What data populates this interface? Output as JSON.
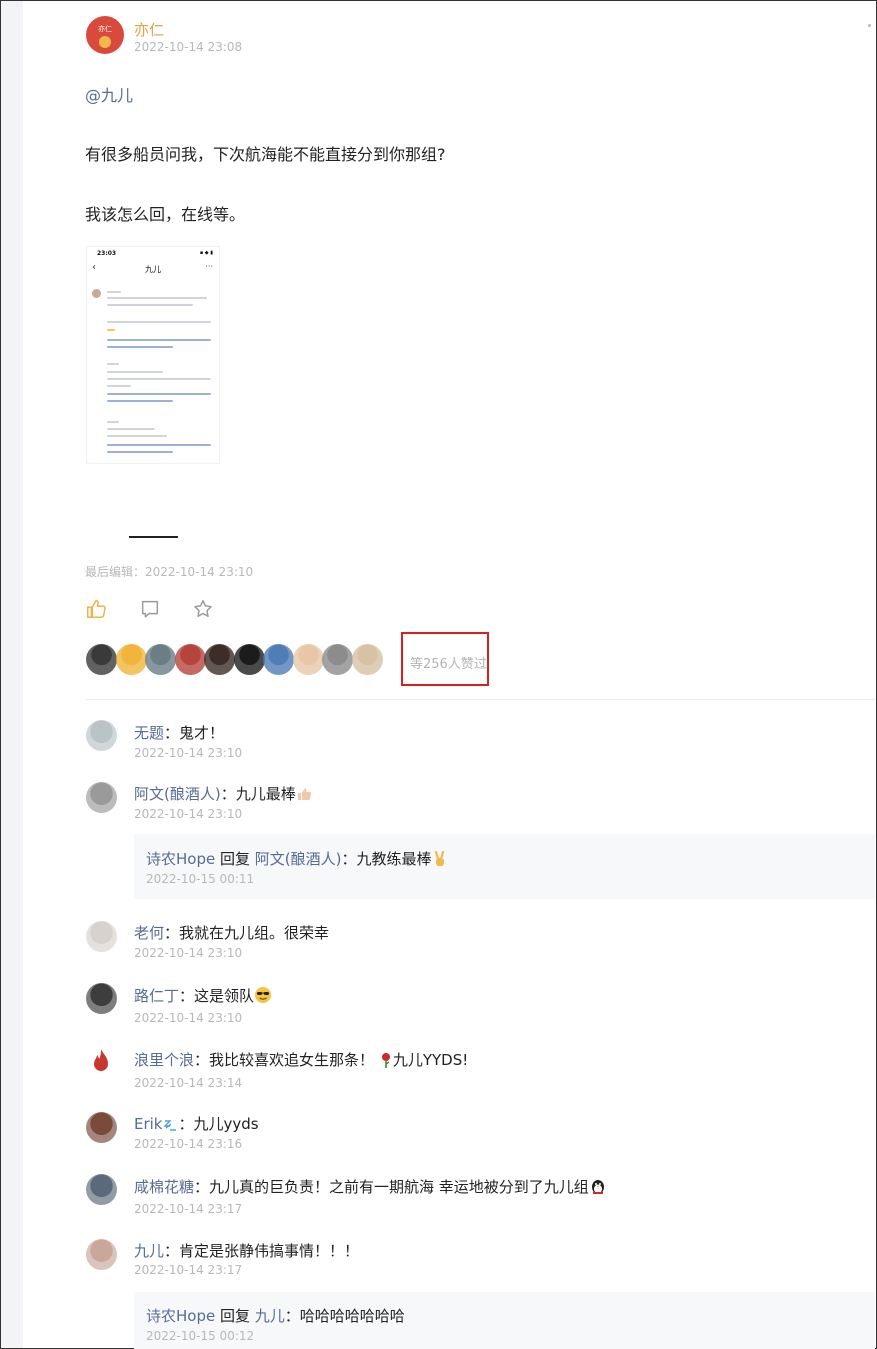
{
  "post": {
    "author": "亦仁",
    "author_avatar_text": "亦仁",
    "time": "2022-10-14 23:08",
    "mention": "@九儿",
    "paragraphs": [
      "有很多船员问我，下次航海能不能直接分到你那组?",
      "我该怎么回，在线等。"
    ],
    "last_edited": "最后编辑：2022-10-14 23:10"
  },
  "screenshot_thumb": {
    "status_time": "23:03",
    "title": "九儿",
    "back": "‹",
    "more": "···"
  },
  "likes": {
    "count_text": "等256人赞过",
    "avatar_colors": [
      "#3a3a3a",
      "#f0b53a",
      "#6b7e86",
      "#b5443c",
      "#3c2d28",
      "#1c1c1c",
      "#4f7db5",
      "#e8c7a8",
      "#8c8c8c",
      "#d7c2a5"
    ]
  },
  "comments": [
    {
      "name": "无题",
      "text": "：鬼才！",
      "time": "2022-10-14 23:10",
      "avatar": "#b9c3c8"
    },
    {
      "name": "阿文(酿酒人)",
      "text": "：九儿最棒",
      "time": "2022-10-14 23:10",
      "avatar": "#9a9a9a",
      "emoji": "thumbs-up",
      "reply": {
        "from": "诗农Hope",
        "verb": " 回复 ",
        "to": "阿文(酿酒人)",
        "text": "：九教练最棒",
        "time": "2022-10-15 00:11",
        "emoji": "victory"
      }
    },
    {
      "name": "老何",
      "text": "：我就在九儿组。很荣幸",
      "time": "2022-10-14 23:10",
      "avatar": "#d8d2cc"
    },
    {
      "name": "路仁丁",
      "text": "：这是领队",
      "time": "2022-10-14 23:10",
      "avatar": "#3d3d3d",
      "emoji": "sunglasses"
    },
    {
      "name": "浪里个浪",
      "text": "：我比较喜欢追女生那条！",
      "text2": "九儿YYDS!",
      "time": "2022-10-14 23:14",
      "avatar": "#c7372f",
      "emoji": "rose"
    },
    {
      "name": "Erik",
      "text": "：九儿yyds",
      "time": "2022-10-14 23:16",
      "avatar": "#7a4a3a",
      "emoji": "zzz"
    },
    {
      "name": "咸棉花糖",
      "text": "：九儿真的巨负责！之前有一期航海 幸运地被分到了九儿组",
      "time": "2022-10-14 23:17",
      "avatar": "#5a6a7a",
      "emoji": "penguin"
    },
    {
      "name": "九儿",
      "text": "：肯定是张静伟搞事情！！！",
      "time": "2022-10-14 23:17",
      "avatar": "#c9a79a",
      "reply": {
        "from": "诗农Hope",
        "verb": " 回复 ",
        "to": "九儿",
        "text": "：哈哈哈哈哈哈哈",
        "time": "2022-10-15 00:12"
      }
    }
  ],
  "colors": {
    "link": "#576b95",
    "author": "#e0a24a",
    "like_active": "#f0b04a",
    "highlight_box": "#d9201f"
  }
}
